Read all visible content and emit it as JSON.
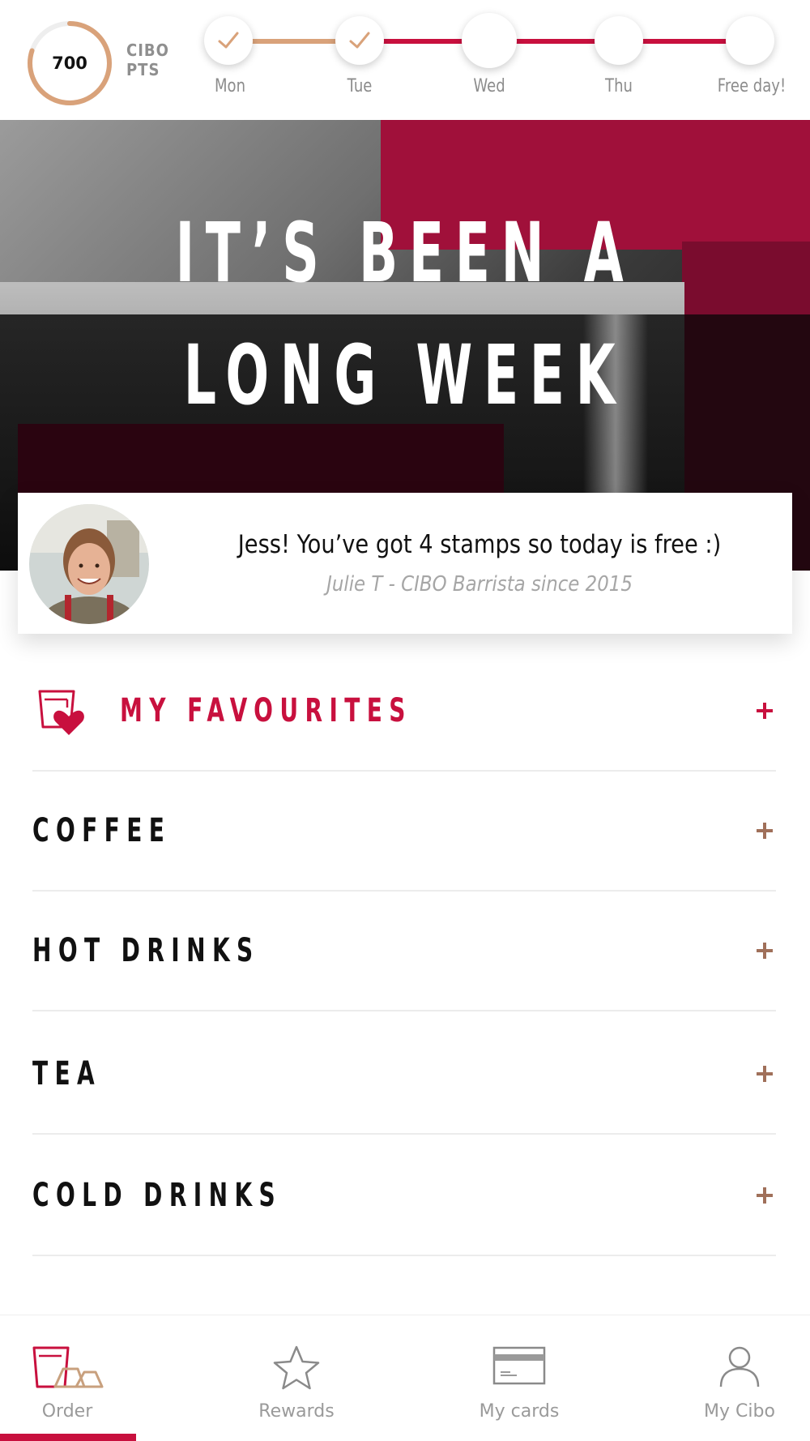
{
  "colors": {
    "brand_red": "#c8103e",
    "tan": "#d9a27a",
    "plus_brown": "#a0705a",
    "muted_text": "#9a9a9a"
  },
  "points": {
    "value": "700",
    "label": "CIBO PTS",
    "progress_fraction": 0.8
  },
  "week": {
    "days": [
      {
        "label": "Mon",
        "completed": true
      },
      {
        "label": "Tue",
        "completed": true
      },
      {
        "label": "Wed",
        "completed": false,
        "current": true
      },
      {
        "label": "Thu",
        "completed": false
      },
      {
        "label": "Free day!",
        "completed": false
      }
    ]
  },
  "hero": {
    "line1": "IT’S BEEN A",
    "line2": "LONG WEEK"
  },
  "quote": {
    "message": "Jess! You’ve got 4 stamps so today is free :)",
    "attribution": "Julie T - CIBO Barrista since 2015",
    "avatar_icon": "barista-avatar"
  },
  "menu": {
    "favourites": "MY FAVOURITES",
    "items": [
      "COFFEE",
      "HOT DRINKS",
      "TEA",
      "COLD DRINKS"
    ]
  },
  "nav": {
    "items": [
      {
        "label": "Order",
        "icon": "order-icon",
        "active": true
      },
      {
        "label": "Rewards",
        "icon": "star-icon",
        "active": false
      },
      {
        "label": "My cards",
        "icon": "card-icon",
        "active": false
      },
      {
        "label": "My Cibo",
        "icon": "person-icon",
        "active": false
      }
    ]
  }
}
